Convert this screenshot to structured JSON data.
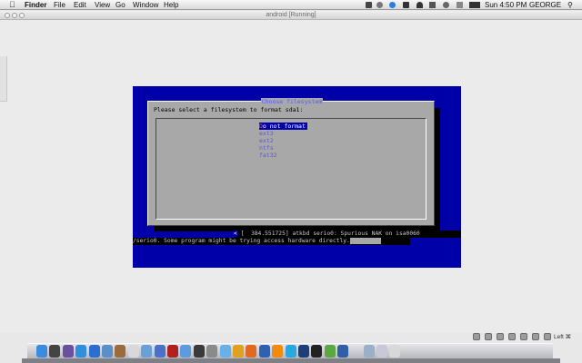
{
  "menubar": {
    "apple_icon": "apple-logo-icon",
    "items": [
      "Finder",
      "File",
      "Edit",
      "View",
      "Go",
      "Window",
      "Help"
    ],
    "clock": "Sun 4:50 PM",
    "user": "GEORGE"
  },
  "window": {
    "title": "android [Running]"
  },
  "installer": {
    "dialog_title": "Choose filesystem",
    "prompt": "Please select a filesystem to format sda1:",
    "options": [
      "Do not format",
      "ext3",
      "ext2",
      "ntfs",
      "fat32"
    ],
    "selected_index": 0
  },
  "console": {
    "line1_marker": "<",
    "line1": " [  384.551725] atkbd serio0: Spurious NAK on isa0060",
    "line2": "/serio0. Some program might be trying access hardware directly."
  },
  "vm_controls": {
    "host_key": "Left ⌘"
  },
  "colors": {
    "vm_background": "#0000a8",
    "dialog_gray": "#a8a8a8",
    "selection": "#0000a8",
    "option_text": "#5858d0"
  }
}
